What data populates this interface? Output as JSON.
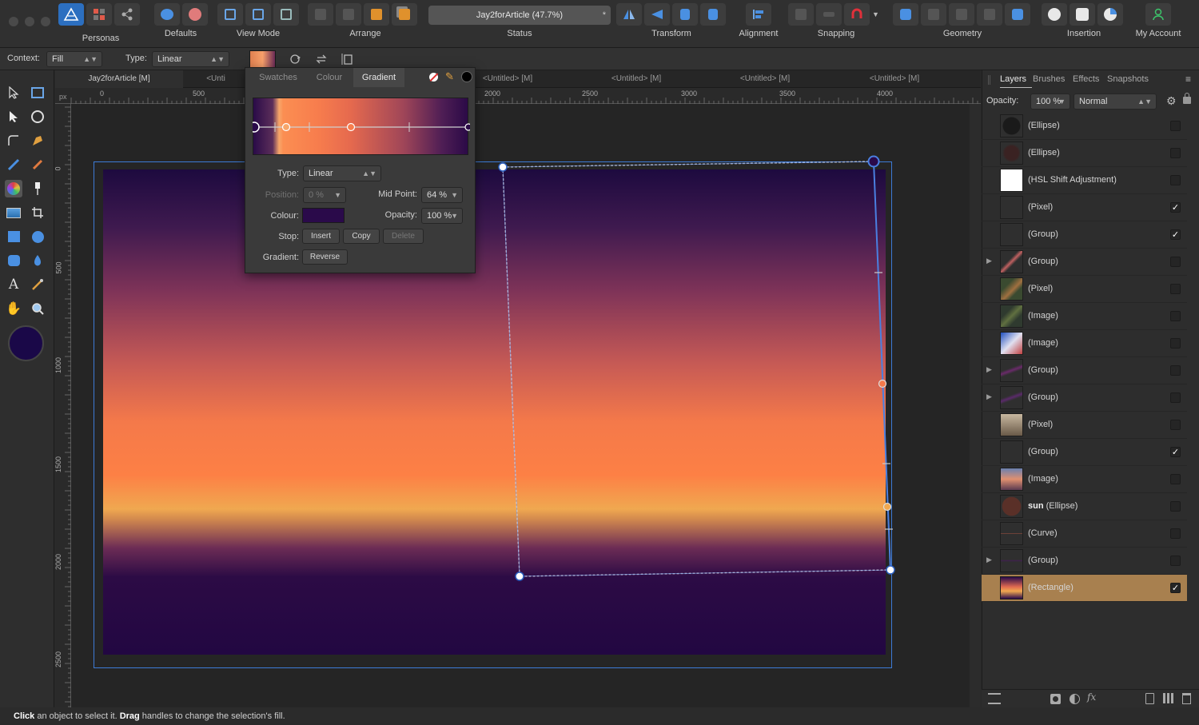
{
  "toolbar": {
    "groups": [
      {
        "label": "Personas"
      },
      {
        "label": "Defaults"
      },
      {
        "label": "View Mode"
      },
      {
        "label": "Arrange"
      },
      {
        "label": "Status"
      },
      {
        "label": "Transform"
      },
      {
        "label": "Alignment"
      },
      {
        "label": "Snapping"
      },
      {
        "label": "Geometry"
      },
      {
        "label": "Insertion"
      },
      {
        "label": "My Account"
      }
    ],
    "document_status": "Jay2forArticle (47.7%)",
    "modified_marker": "*"
  },
  "context_bar": {
    "context_label": "Context:",
    "context_value": "Fill",
    "type_label": "Type:",
    "type_value": "Linear"
  },
  "doc_tabs": [
    "Jay2forArticle [M]",
    "<Unti",
    "<Untitled> [M]",
    "<Untitled> [M]",
    "<Untitled> [M]",
    "<Untitled> [M]"
  ],
  "ruler": {
    "unit": "px",
    "h_ticks": [
      "0",
      "500",
      "2000",
      "2500",
      "3000",
      "3500",
      "4000"
    ],
    "v_ticks": [
      "0",
      "500",
      "1000",
      "1500",
      "2000",
      "2500"
    ]
  },
  "gradient_panel": {
    "tabs": [
      "Swatches",
      "Colour",
      "Gradient"
    ],
    "active_tab": "Gradient",
    "type_label": "Type:",
    "type_value": "Linear",
    "position_label": "Position:",
    "position_value": "0 %",
    "midpoint_label": "Mid Point:",
    "midpoint_value": "64 %",
    "colour_label": "Colour:",
    "colour_value": "#2a0a4a",
    "opacity_label": "Opacity:",
    "opacity_value": "100 %",
    "stop_label": "Stop:",
    "insert_label": "Insert",
    "copy_label": "Copy",
    "delete_label": "Delete",
    "gradient_label": "Gradient:",
    "reverse_label": "Reverse"
  },
  "right_panel": {
    "tabs": [
      "Layers",
      "Brushes",
      "Effects",
      "Snapshots"
    ],
    "active_tab": "Layers",
    "opacity_label": "Opacity:",
    "opacity_value": "100 %",
    "blend_mode": "Normal",
    "layers": [
      {
        "name": "(Ellipse)",
        "checked": false,
        "expandable": false,
        "selected": false
      },
      {
        "name": "(Ellipse)",
        "checked": false,
        "expandable": false,
        "selected": false
      },
      {
        "name": "(HSL Shift Adjustment)",
        "checked": false,
        "expandable": false,
        "selected": false
      },
      {
        "name": "(Pixel)",
        "checked": true,
        "expandable": false,
        "selected": false
      },
      {
        "name": "(Group)",
        "checked": true,
        "expandable": false,
        "selected": false
      },
      {
        "name": "(Group)",
        "checked": false,
        "expandable": true,
        "selected": false
      },
      {
        "name": "(Pixel)",
        "checked": false,
        "expandable": false,
        "selected": false
      },
      {
        "name": "(Image)",
        "checked": false,
        "expandable": false,
        "selected": false
      },
      {
        "name": "(Image)",
        "checked": false,
        "expandable": false,
        "selected": false
      },
      {
        "name": "(Group)",
        "checked": false,
        "expandable": true,
        "selected": false
      },
      {
        "name": "(Group)",
        "checked": false,
        "expandable": true,
        "selected": false
      },
      {
        "name": "(Pixel)",
        "checked": false,
        "expandable": false,
        "selected": false
      },
      {
        "name": "(Group)",
        "checked": true,
        "expandable": false,
        "selected": false
      },
      {
        "name": "(Image)",
        "checked": false,
        "expandable": false,
        "selected": false
      },
      {
        "name": "(Ellipse)",
        "bold_prefix": "sun",
        "checked": false,
        "expandable": false,
        "selected": false
      },
      {
        "name": "(Curve)",
        "checked": false,
        "expandable": false,
        "selected": false
      },
      {
        "name": "(Group)",
        "checked": false,
        "expandable": true,
        "selected": false
      },
      {
        "name": "(Rectangle)",
        "checked": true,
        "expandable": false,
        "selected": true
      }
    ]
  },
  "status_bar": {
    "click_word": "Click",
    "click_text": " an object to select it. ",
    "drag_word": "Drag",
    "drag_text": " handles to change the selection's fill."
  },
  "colors": {
    "accent": "#2c6fc0",
    "primary_colour_well": "#1a0848",
    "selected_layer": "#a8804f"
  }
}
